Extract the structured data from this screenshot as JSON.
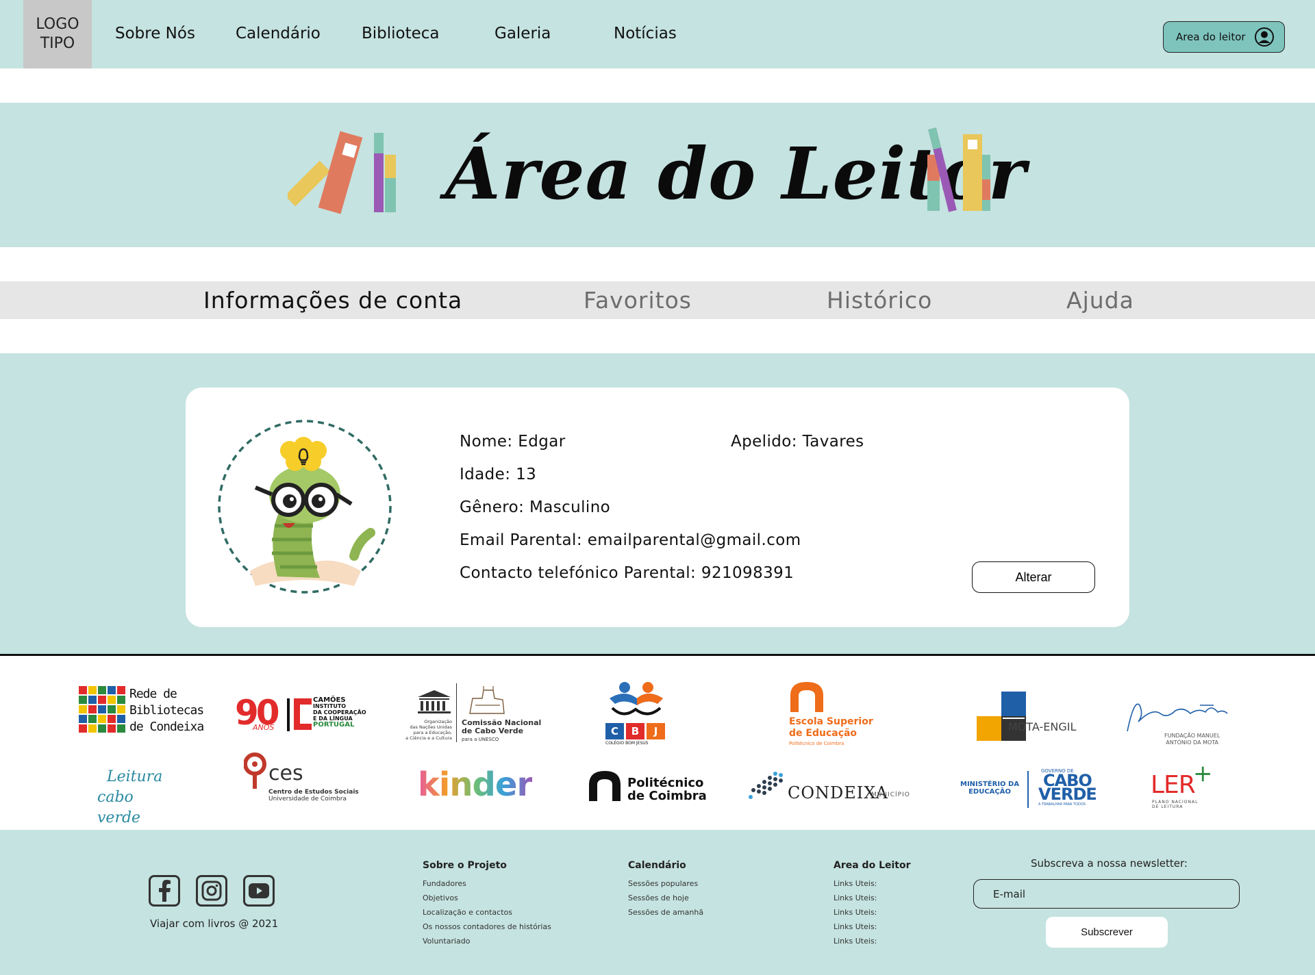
{
  "header": {
    "logo_line1": "LOGO",
    "logo_line2": "TIPO",
    "nav": [
      "Sobre Nós",
      "Calendário",
      "Biblioteca",
      "Galeria",
      "Notícias"
    ],
    "reader_button": "Area do leitor",
    "reader_icon": "user-circle-icon"
  },
  "hero": {
    "title": "Área do Leitor"
  },
  "tabs": [
    "Informações de conta",
    "Favoritos",
    "Histórico",
    "Ajuda"
  ],
  "account": {
    "name_label": "Nome: Edgar",
    "surname_label": "Apelido: Tavares",
    "age_label": "Idade: 13",
    "gender_label": "Gênero: Masculino",
    "email_label": "Email Parental: emailparental@gmail.com",
    "phone_label": "Contacto telefónico Parental: 921098391",
    "alter_button": "Alterar",
    "avatar_icon": "bookworm-avatar"
  },
  "partners": {
    "rede": [
      "Rede de",
      "Bibliotecas",
      "de Condeixa"
    ],
    "camoes_num": "90",
    "camoes_anos": "ANOS",
    "camoes_lines": [
      "CAMÕES",
      "INSTITUTO",
      "DA COOPERAÇÃO",
      "E DA LÍNGUA",
      "PORTUGAL"
    ],
    "unesco": "UNESCO",
    "unesco_sub": [
      "Organização",
      "das Nações Unidas",
      "para a Educação,",
      "a Ciência e a Cultura"
    ],
    "cabo_verde_commission": [
      "Comissão Nacional",
      "de Cabo Verde",
      "para a UNESCO"
    ],
    "cbj": [
      "C",
      "B",
      "J"
    ],
    "cbj_sub": "COLÉGIO BOM JESUS",
    "escola": [
      "Escola Superior",
      "de Educação"
    ],
    "escola_sub": "Politécnico de Coimbra",
    "mota": "MOTA-ENGIL",
    "fundacao": [
      "FUNDAÇÃO MANUEL",
      "ANTÓNIO DA MOTA"
    ],
    "leitura": [
      "Leitura",
      "cabo verde"
    ],
    "ces": "ces",
    "ces_sub": [
      "Centro de Estudos Sociais",
      "Universidade de Coimbra"
    ],
    "kinder": "kinder",
    "politecnico": [
      "Politécnico",
      "de Coimbra"
    ],
    "condeixa": "CONDEIXA",
    "condeixa_sub": "MUNICÍPIO",
    "ministerio": [
      "MINISTÉRIO DA",
      "EDUCAÇÃO"
    ],
    "governo": "GOVERNO DE",
    "cabo_verde": [
      "CABO",
      "VERDE"
    ],
    "cv_sub": "A TRABALHAR PARA TODOS",
    "ler": "LER",
    "ler_sub": [
      "PLANO NACIONAL",
      "DE LEITURA"
    ],
    "colors": {
      "orange": "#ef6c1a",
      "red": "#e22b2b",
      "blue": "#1f5fa8",
      "teal": "#2a8aa0"
    }
  },
  "footer": {
    "social_icons": [
      "facebook-icon",
      "instagram-icon",
      "youtube-icon"
    ],
    "copyright": "Viajar com livros @ 2021",
    "col1_title": "Sobre o Projeto",
    "col1": [
      "Fundadores",
      "Objetivos",
      "Localização e contactos",
      "Os nossos contadores de histórias",
      "Voluntariado"
    ],
    "col2_title": "Calendário",
    "col2": [
      "Sessões populares",
      "Sessões de hoje",
      "Sessões de amanhã"
    ],
    "col3_title": "Area do Leitor",
    "col3": [
      "Links Uteis:",
      "Links Uteis:",
      "Links Uteis:",
      "Links Uteis:",
      "Links Uteis:"
    ],
    "newsletter_title": "Subscreva a nossa newsletter:",
    "email_placeholder": "E-mail",
    "subscribe_button": "Subscrever"
  },
  "colors": {
    "mint": "#c5e3e0",
    "button_teal": "#7ec4bd",
    "tab_bg": "#e6e6e6"
  }
}
